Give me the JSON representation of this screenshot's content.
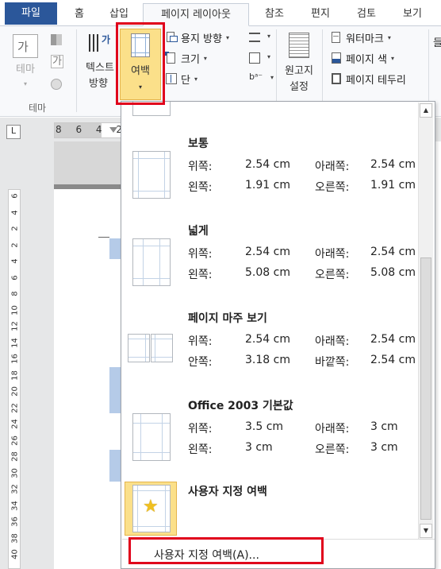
{
  "tabs": [
    {
      "label": "파일"
    },
    {
      "label": "홈"
    },
    {
      "label": "삽입"
    },
    {
      "label": "페이지 레이아웃"
    },
    {
      "label": "참조"
    },
    {
      "label": "편지"
    },
    {
      "label": "검토"
    },
    {
      "label": "보기"
    }
  ],
  "ribbon": {
    "theme_label": "테마",
    "theme_group": "테마",
    "text_direction_1": "텍스트",
    "text_direction_2": "방향",
    "margins_label": "여백",
    "orientation": "용지 방향",
    "size": "크기",
    "columns": "단",
    "manuscript_1": "원고지",
    "manuscript_2": "설정",
    "watermark": "워터마크",
    "page_color": "페이지 색",
    "page_borders": "페이지 테두리",
    "theme_icon_text": "가",
    "font_icon_text": "가",
    "cut_right": "들"
  },
  "ruler": {
    "corner_symbol": "L",
    "h_text": "8 6 4 2",
    "v_numbers": [
      "6",
      "4",
      "2",
      "2",
      "4",
      "6",
      "8",
      "10",
      "12",
      "14",
      "16",
      "18",
      "20",
      "22",
      "24",
      "26",
      "28",
      "30",
      "32",
      "34",
      "36",
      "38",
      "40"
    ]
  },
  "margin_presets": [
    {
      "name": "보통",
      "top_label": "위쪽:",
      "top": "2.54 cm",
      "bottom_label": "아래쪽:",
      "bottom": "2.54 cm",
      "left_label": "왼쪽:",
      "left": "1.91 cm",
      "right_label": "오른쪽:",
      "right": "1.91 cm"
    },
    {
      "name": "넓게",
      "top_label": "위쪽:",
      "top": "2.54 cm",
      "bottom_label": "아래쪽:",
      "bottom": "2.54 cm",
      "left_label": "왼쪽:",
      "left": "5.08 cm",
      "right_label": "오른쪽:",
      "right": "5.08 cm"
    },
    {
      "name": "페이지 마주 보기",
      "top_label": "위쪽:",
      "top": "2.54 cm",
      "bottom_label": "아래쪽:",
      "bottom": "2.54 cm",
      "left_label": "안쪽:",
      "left": "3.18 cm",
      "right_label": "바깥쪽:",
      "right": "2.54 cm"
    },
    {
      "name": "Office 2003 기본값",
      "top_label": "위쪽:",
      "top": "3.5 cm",
      "bottom_label": "아래쪽:",
      "bottom": "3 cm",
      "left_label": "왼쪽:",
      "left": "3 cm",
      "right_label": "오른쪽:",
      "right": "3 cm"
    }
  ],
  "custom_preset": {
    "name": "사용자 지정 여백"
  },
  "footer": {
    "label": "사용자 지정 여백(A)..."
  },
  "colors": {
    "file_tab": "#2b579a",
    "highlight": "#fbe08a",
    "annotation_red": "#e0001b"
  }
}
